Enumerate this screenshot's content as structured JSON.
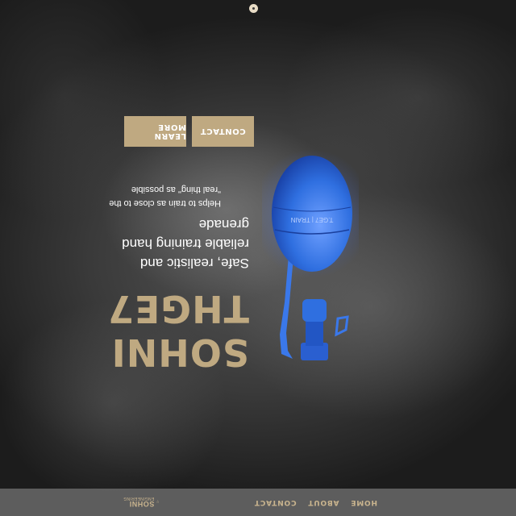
{
  "nav": {
    "logo": {
      "name": "SOHNI",
      "tagline": "ENGINEERING"
    },
    "links": [
      "HOME",
      "ABOUT",
      "CONTACT"
    ]
  },
  "hero": {
    "title_line1": "SOHNI",
    "title_line2": "THGE7",
    "subtitle": "Safe, realistic and reliable training hand grenade",
    "description": "Helps to train as close to the \"real thing\" as possible",
    "buttons": {
      "learn_more": "LEARN MORE",
      "contact": "CONTACT"
    },
    "product_label": "T.GE7 | TRAIN"
  },
  "colors": {
    "accent": "#bfa981",
    "grenade": "#2f6fe0",
    "navbar": "#696969"
  },
  "icons": {
    "logo": "deer-head-icon",
    "scroll": "scroll-indicator-icon"
  }
}
